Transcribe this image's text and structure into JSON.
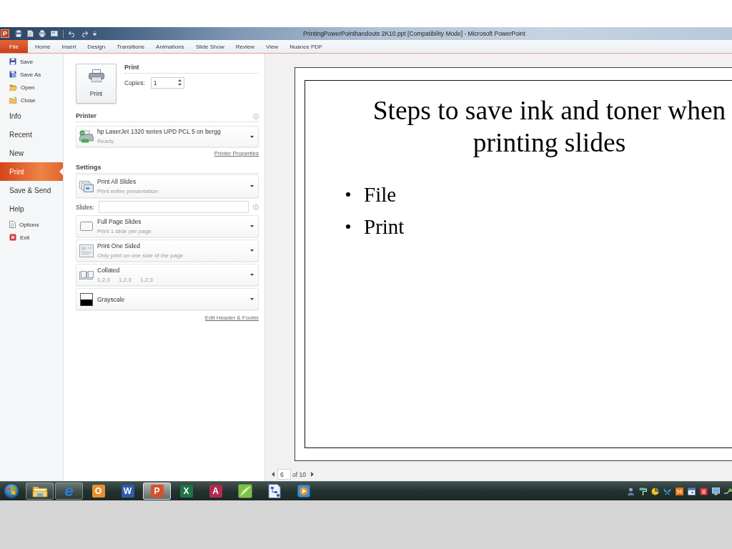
{
  "window": {
    "app_letter": "P",
    "title": "PrintingPowerPointhandouts 2K10.ppt [Compatibility Mode] - Microsoft PowerPoint"
  },
  "ribbon_tabs": [
    {
      "label": "File",
      "selected": true
    },
    {
      "label": "Home",
      "selected": false
    },
    {
      "label": "Insert",
      "selected": false
    },
    {
      "label": "Design",
      "selected": false
    },
    {
      "label": "Transitions",
      "selected": false
    },
    {
      "label": "Animations",
      "selected": false
    },
    {
      "label": "Slide Show",
      "selected": false
    },
    {
      "label": "Review",
      "selected": false
    },
    {
      "label": "View",
      "selected": false
    },
    {
      "label": "Nuance PDF",
      "selected": false
    }
  ],
  "backstage_nav": [
    {
      "label": "Save",
      "kind": "command",
      "selected": false
    },
    {
      "label": "Save As",
      "kind": "command",
      "selected": false
    },
    {
      "label": "Open",
      "kind": "command",
      "selected": false
    },
    {
      "label": "Close",
      "kind": "command",
      "selected": false
    },
    {
      "label": "Info",
      "kind": "page",
      "selected": false
    },
    {
      "label": "Recent",
      "kind": "page",
      "selected": false
    },
    {
      "label": "New",
      "kind": "page",
      "selected": false
    },
    {
      "label": "Print",
      "kind": "page",
      "selected": true
    },
    {
      "label": "Save & Send",
      "kind": "page",
      "selected": false
    },
    {
      "label": "Help",
      "kind": "page",
      "selected": false
    },
    {
      "label": "Options",
      "kind": "command",
      "selected": false
    },
    {
      "label": "Exit",
      "kind": "command",
      "selected": false
    }
  ],
  "print": {
    "heading": "Print",
    "button_label": "Print",
    "copies_label": "Copies:",
    "copies_value": "1"
  },
  "printer": {
    "heading": "Printer",
    "name": "hp LaserJet 1320 series UPD PCL 5 on bergg",
    "status": "Ready",
    "link": "Printer Properties"
  },
  "settings": {
    "heading": "Settings",
    "items": [
      {
        "kind": "range",
        "title": "Print All Slides",
        "subtitle": "Print entire presentation"
      },
      {
        "kind": "field",
        "label": "Slides:"
      },
      {
        "kind": "layout",
        "title": "Full Page Slides",
        "subtitle": "Print 1 slide per page"
      },
      {
        "kind": "sides",
        "title": "Print One Sided",
        "subtitle": "Only print on one side of the page"
      },
      {
        "kind": "collation",
        "title": "Collated",
        "subtitle": "1,2,3 1,2,3 1,2,3"
      },
      {
        "kind": "color",
        "title": "Grayscale"
      }
    ],
    "link": "Edit Header & Footer"
  },
  "preview": {
    "slide": {
      "title": "Steps to save ink and toner when printing slides",
      "bullets": [
        "File",
        "Print"
      ]
    },
    "page_number": "6",
    "page_count": "of 10"
  },
  "taskbar": {
    "apps": [
      {
        "kind": "folder",
        "running": true,
        "selected": false
      },
      {
        "kind": "glyph",
        "letter": "e",
        "running": true,
        "selected": false
      },
      {
        "kind": "tile",
        "letter": "O",
        "color": "#e8912c",
        "running": false,
        "selected": false
      },
      {
        "kind": "tile",
        "letter": "W",
        "color": "#2d5cae",
        "running": false,
        "selected": false
      },
      {
        "kind": "tile",
        "letter": "P",
        "color": "#d35230",
        "running": true,
        "selected": true
      },
      {
        "kind": "tile",
        "letter": "X",
        "color": "#217346",
        "running": false,
        "selected": false
      },
      {
        "kind": "tile",
        "letter": "A",
        "color": "#b02a52",
        "running": false,
        "selected": false
      },
      {
        "kind": "leaf",
        "running": false,
        "selected": false
      },
      {
        "kind": "diagram",
        "running": false,
        "selected": false
      },
      {
        "kind": "media",
        "running": false,
        "selected": false
      }
    ],
    "tray_badge": "56"
  }
}
